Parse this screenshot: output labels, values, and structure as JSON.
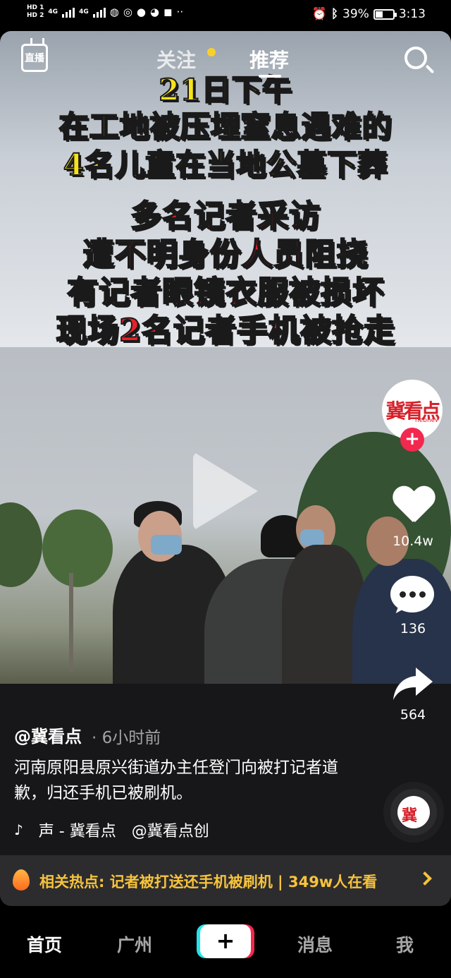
{
  "status_bar": {
    "time": "3:13",
    "battery": "39%",
    "network_1": "HD 1",
    "network_2": "HD 2",
    "signal_label": "4G"
  },
  "top_nav": {
    "live_label": "直播",
    "tab_follow": "关注",
    "tab_recommend": "推荐",
    "search_icon": "search-icon"
  },
  "banner": {
    "yellow_lines": [
      "21日下午",
      "在工地被压埋窒息遇难的",
      "4名儿童在当地公墓下葬"
    ],
    "red_lines": [
      "多名记者采访",
      "遭不明身份人员阻挠",
      "有记者眼镜衣服被损坏",
      "现场2名记者手机被抢走"
    ]
  },
  "rail": {
    "avatar_text": "冀看点",
    "avatar_sub": "hebnews",
    "follow_plus": "+",
    "likes": "10.4w",
    "comments": "136",
    "shares": "564"
  },
  "post": {
    "author": "@冀看点",
    "time": "· 6小时前",
    "description": "河南原阳县原兴街道办主任登门向被打记者道歉，归还手机已被刷机。",
    "music_prefix": "♪",
    "music": "声 - 冀看点",
    "music_author": "@冀看点创",
    "disc_text": "冀"
  },
  "hot": {
    "text": "相关热点: 记者被打送还手机被刷机 | 349w人在看"
  },
  "bottom_nav": {
    "home": "首页",
    "city": "广州",
    "plus": "+",
    "messages": "消息",
    "me": "我"
  },
  "colors": {
    "accent_red": "#f3284f",
    "accent_cyan": "#25e3e8",
    "hot_yellow": "#f7c33b",
    "banner_yellow": "#f7e21b",
    "banner_red": "#e8202a"
  }
}
